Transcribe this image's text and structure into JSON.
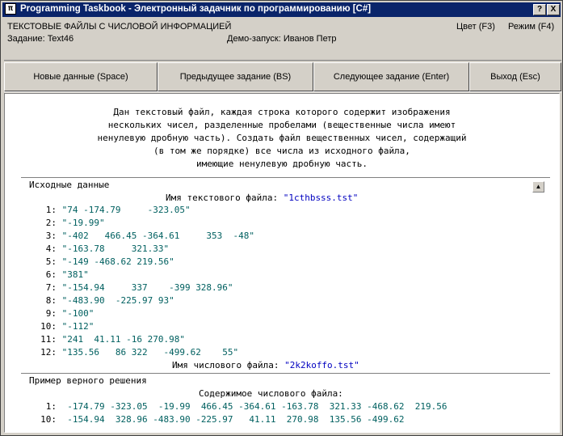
{
  "window": {
    "title": "Programming Taskbook - Электронный задачник по программированию [C#]",
    "help_label": "?",
    "close_label": "X"
  },
  "info": {
    "group": "ТЕКСТОВЫЕ ФАЙЛЫ С ЧИСЛОВОЙ ИНФОРМАЦИЕЙ",
    "task": "Задание: Text46",
    "demo": "Демо-запуск: Иванов Петр",
    "color": "Цвет (F3)",
    "mode": "Режим (F4)"
  },
  "buttons": {
    "new_data": "Новые данные (Space)",
    "prev_task": "Предыдущее задание (BS)",
    "next_task": "Следующее задание (Enter)",
    "exit": "Выход (Esc)"
  },
  "task_text": [
    "Дан текстовый файл, каждая строка которого содержит изображения",
    "нескольких чисел, разделенные пробелами (вещественные числа имеют",
    "ненулевую дробную часть). Создать файл вещественных чисел, содержащий",
    "(в том же порядке) все числа из исходного файла,",
    "имеющие ненулевую дробную часть."
  ],
  "source": {
    "heading": "Исходные данные",
    "text_file_label": "Имя текстового файла: ",
    "text_file_name": "\"1cthbsss.tst\"",
    "lines": [
      {
        "num": "1:",
        "text": "\"74 -174.79     -323.05\""
      },
      {
        "num": "2:",
        "text": "\"-19.99\""
      },
      {
        "num": "3:",
        "text": "\"-402   466.45 -364.61     353  -48\""
      },
      {
        "num": "4:",
        "text": "\"-163.78     321.33\""
      },
      {
        "num": "5:",
        "text": "\"-149 -468.62 219.56\""
      },
      {
        "num": "6:",
        "text": "\"381\""
      },
      {
        "num": "7:",
        "text": "\"-154.94     337    -399 328.96\""
      },
      {
        "num": "8:",
        "text": "\"-483.90  -225.97 93\""
      },
      {
        "num": "9:",
        "text": "\"-100\""
      },
      {
        "num": "10:",
        "text": "\"-112\""
      },
      {
        "num": "11:",
        "text": "\"241  41.11 -16 270.98\""
      },
      {
        "num": "12:",
        "text": "\"135.56   86 322   -499.62    55\""
      }
    ],
    "num_file_label": "Имя числового файла: ",
    "num_file_name": "\"2k2koffo.tst\""
  },
  "solution": {
    "heading": "Пример верного решения",
    "content_label": "Содержимое числового файла:",
    "rows": [
      {
        "num": "1:",
        "text": "-174.79 -323.05  -19.99  466.45 -364.61 -163.78  321.33 -468.62  219.56"
      },
      {
        "num": "10:",
        "text": "-154.94  328.96 -483.90 -225.97   41.11  270.98  135.56 -499.62"
      }
    ]
  }
}
